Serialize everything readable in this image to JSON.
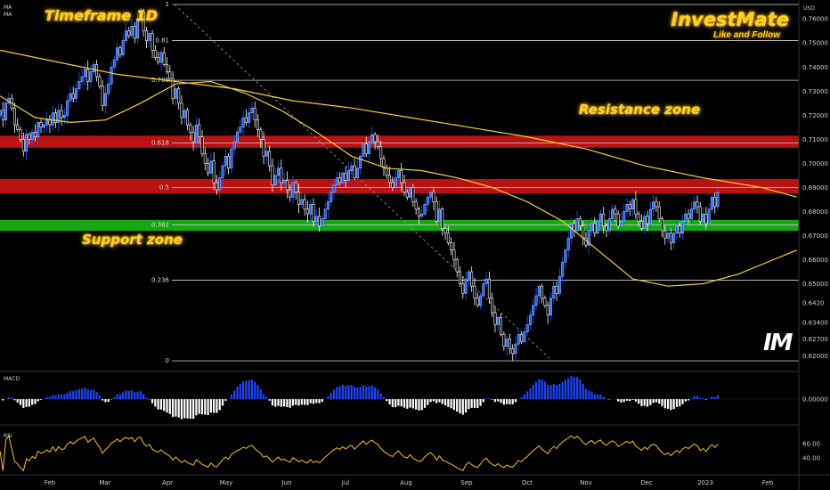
{
  "header": {
    "timeframe": "Timeframe 1D",
    "brand_name": "InvestMate",
    "brand_tagline": "Like and Follow",
    "indicator_labels": [
      "MA",
      "MA"
    ],
    "currency": "USD",
    "logo_text": "IM"
  },
  "annotations": {
    "resistance": "Resistance zone",
    "support": "Support zone"
  },
  "colors": {
    "background": "#000000",
    "bull": "#1e5bff",
    "bear": "#ffffff",
    "ma_fast": "#f2cf3a",
    "ma_slow": "#f2cf3a",
    "resistance_band": "#c81414",
    "support_band": "#18b418",
    "macd_pos": "#1e44ff",
    "macd_neg": "#ffffff",
    "rsi": "#f2c21b",
    "annotation": "#ffd31a"
  },
  "chart_data": [
    {
      "type": "candlestick",
      "name": "price",
      "y_ticks": [
        "0.76000",
        "0.75000",
        "0.74000",
        "0.73000",
        "0.72000",
        "0.71000",
        "0.70000",
        "0.69000",
        "0.68000",
        "0.67000",
        "0.66000",
        "0.65000",
        "0.6420",
        "0.63400",
        "0.62700",
        "0.62000"
      ],
      "x_ticks": [
        "Feb",
        "Mar",
        "Apr",
        "May",
        "Jun",
        "Jul",
        "Aug",
        "Sep",
        "Oct",
        "Nov",
        "Dec",
        "2023",
        "Feb"
      ],
      "fib_levels": [
        {
          "label": "1",
          "value": 0.766
        },
        {
          "label": "0.81",
          "value": 0.751
        },
        {
          "label": "0.786",
          "value": 0.7345
        },
        {
          "label": "0.618",
          "value": 0.7085
        },
        {
          "label": "0.5",
          "value": 0.69
        },
        {
          "label": "0.382",
          "value": 0.6745
        },
        {
          "label": "0.236",
          "value": 0.6515
        },
        {
          "label": "0",
          "value": 0.618
        }
      ],
      "zones": [
        {
          "kind": "resistance",
          "low": 0.7065,
          "high": 0.7115
        },
        {
          "kind": "resistance",
          "low": 0.6875,
          "high": 0.6935
        },
        {
          "kind": "support",
          "low": 0.672,
          "high": 0.6765
        }
      ],
      "ma_fast": [
        [
          0,
          0.728
        ],
        [
          12,
          0.719
        ],
        [
          24,
          0.717
        ],
        [
          36,
          0.718
        ],
        [
          48,
          0.725
        ],
        [
          60,
          0.733
        ],
        [
          72,
          0.734
        ],
        [
          84,
          0.729
        ],
        [
          96,
          0.722
        ],
        [
          108,
          0.713
        ],
        [
          120,
          0.703
        ],
        [
          132,
          0.698
        ],
        [
          144,
          0.697
        ],
        [
          156,
          0.694
        ],
        [
          168,
          0.69
        ],
        [
          180,
          0.684
        ],
        [
          192,
          0.676
        ],
        [
          204,
          0.664
        ],
        [
          216,
          0.652
        ],
        [
          228,
          0.649
        ],
        [
          240,
          0.65
        ],
        [
          252,
          0.654
        ],
        [
          264,
          0.66
        ],
        [
          272,
          0.664
        ]
      ],
      "ma_slow": [
        [
          0,
          0.747
        ],
        [
          20,
          0.742
        ],
        [
          40,
          0.737
        ],
        [
          60,
          0.734
        ],
        [
          80,
          0.731
        ],
        [
          100,
          0.726
        ],
        [
          120,
          0.723
        ],
        [
          140,
          0.719
        ],
        [
          160,
          0.715
        ],
        [
          180,
          0.711
        ],
        [
          200,
          0.706
        ],
        [
          220,
          0.699
        ],
        [
          240,
          0.694
        ],
        [
          260,
          0.69
        ],
        [
          272,
          0.686
        ]
      ],
      "ohlc_sample_note": "",
      "close": [
        0.722,
        0.718,
        0.725,
        0.727,
        0.723,
        0.716,
        0.714,
        0.71,
        0.705,
        0.712,
        0.71,
        0.713,
        0.711,
        0.717,
        0.715,
        0.716,
        0.718,
        0.716,
        0.721,
        0.717,
        0.722,
        0.719,
        0.72,
        0.726,
        0.729,
        0.727,
        0.731,
        0.734,
        0.736,
        0.739,
        0.734,
        0.738,
        0.741,
        0.736,
        0.732,
        0.724,
        0.729,
        0.733,
        0.74,
        0.743,
        0.748,
        0.745,
        0.751,
        0.755,
        0.753,
        0.757,
        0.752,
        0.76,
        0.763,
        0.755,
        0.751,
        0.754,
        0.747,
        0.744,
        0.742,
        0.746,
        0.741,
        0.738,
        0.735,
        0.727,
        0.731,
        0.725,
        0.719,
        0.722,
        0.716,
        0.713,
        0.709,
        0.716,
        0.711,
        0.704,
        0.7,
        0.696,
        0.701,
        0.692,
        0.689,
        0.694,
        0.699,
        0.703,
        0.698,
        0.706,
        0.709,
        0.713,
        0.715,
        0.719,
        0.717,
        0.721,
        0.723,
        0.718,
        0.714,
        0.71,
        0.703,
        0.705,
        0.699,
        0.691,
        0.695,
        0.698,
        0.692,
        0.693,
        0.689,
        0.686,
        0.692,
        0.688,
        0.683,
        0.685,
        0.681,
        0.679,
        0.683,
        0.676,
        0.678,
        0.674,
        0.677,
        0.681,
        0.684,
        0.688,
        0.691,
        0.694,
        0.692,
        0.696,
        0.693,
        0.697,
        0.699,
        0.694,
        0.698,
        0.703,
        0.708,
        0.704,
        0.709,
        0.712,
        0.709,
        0.707,
        0.702,
        0.698,
        0.695,
        0.692,
        0.69,
        0.694,
        0.697,
        0.692,
        0.688,
        0.686,
        0.69,
        0.684,
        0.681,
        0.678,
        0.679,
        0.683,
        0.686,
        0.688,
        0.684,
        0.676,
        0.681,
        0.673,
        0.671,
        0.667,
        0.664,
        0.66,
        0.655,
        0.65,
        0.646,
        0.652,
        0.655,
        0.649,
        0.644,
        0.641,
        0.645,
        0.65,
        0.652,
        0.644,
        0.638,
        0.633,
        0.636,
        0.629,
        0.624,
        0.627,
        0.623,
        0.621,
        0.625,
        0.629,
        0.626,
        0.63,
        0.633,
        0.637,
        0.641,
        0.645,
        0.649,
        0.644,
        0.641,
        0.637,
        0.644,
        0.649,
        0.646,
        0.653,
        0.659,
        0.664,
        0.669,
        0.675,
        0.672,
        0.677,
        0.674,
        0.669,
        0.666,
        0.672,
        0.675,
        0.671,
        0.676,
        0.679,
        0.674,
        0.672,
        0.677,
        0.681,
        0.679,
        0.674,
        0.676,
        0.68,
        0.683,
        0.681,
        0.685,
        0.679,
        0.676,
        0.673,
        0.678,
        0.675,
        0.681,
        0.684,
        0.682,
        0.677,
        0.672,
        0.669,
        0.671,
        0.667,
        0.671,
        0.674,
        0.671,
        0.676,
        0.679,
        0.677,
        0.681,
        0.684,
        0.682,
        0.676,
        0.679,
        0.675,
        0.681,
        0.686,
        0.682,
        0.688
      ]
    },
    {
      "type": "bar",
      "name": "MACD",
      "title": "MACD",
      "y_ticks": [
        "0.00000"
      ]
    },
    {
      "type": "line",
      "name": "RSI",
      "title": "RSI",
      "y_ticks": [
        "60.00",
        "40.00"
      ],
      "ylim": [
        20,
        80
      ]
    }
  ]
}
